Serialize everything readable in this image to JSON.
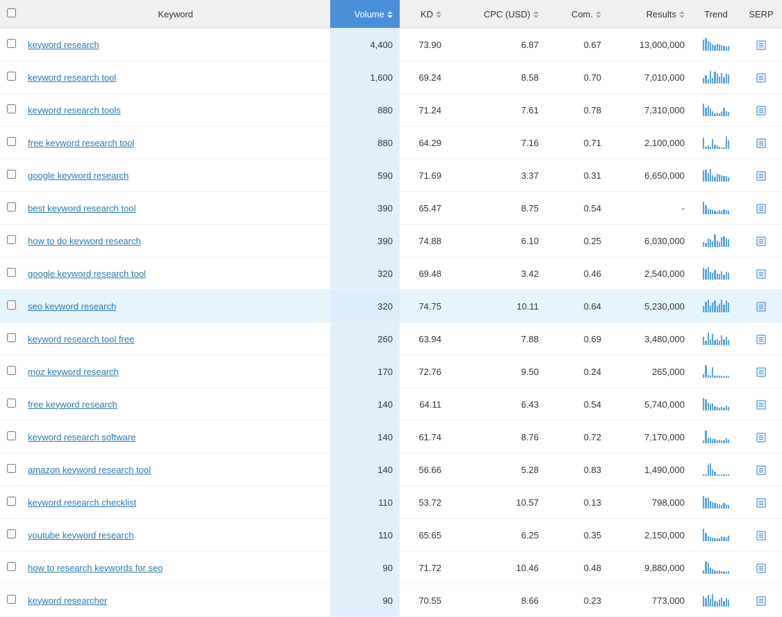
{
  "headers": {
    "keyword": "Keyword",
    "volume": "Volume",
    "kd": "KD",
    "cpc": "CPC (USD)",
    "com": "Com.",
    "results": "Results",
    "trend": "Trend",
    "serp": "SERP"
  },
  "highlight_index": 8,
  "rows": [
    {
      "keyword": "keyword research",
      "volume": "4,400",
      "kd": "73.90",
      "cpc": "6.87",
      "com": "0.67",
      "results": "13,000,000",
      "trend": [
        70,
        80,
        60,
        55,
        40,
        35,
        45,
        38,
        35,
        30,
        28,
        30
      ]
    },
    {
      "keyword": "keyword research tool",
      "volume": "1,600",
      "kd": "69.24",
      "cpc": "8.58",
      "com": "0.70",
      "results": "7,010,000",
      "trend": [
        30,
        45,
        25,
        70,
        30,
        65,
        55,
        40,
        60,
        35,
        55,
        50
      ]
    },
    {
      "keyword": "keyword research tools",
      "volume": "880",
      "kd": "71.24",
      "cpc": "7.61",
      "com": "0.78",
      "results": "7,310,000",
      "trend": [
        90,
        60,
        75,
        55,
        35,
        20,
        25,
        22,
        28,
        60,
        35,
        30
      ]
    },
    {
      "keyword": "free keyword research tool",
      "volume": "880",
      "kd": "64.29",
      "cpc": "7.16",
      "com": "0.71",
      "results": "2,100,000",
      "trend": [
        70,
        15,
        20,
        15,
        60,
        25,
        20,
        15,
        10,
        10,
        80,
        55
      ]
    },
    {
      "keyword": "google keyword research",
      "volume": "590",
      "kd": "71.69",
      "cpc": "3.37",
      "com": "0.31",
      "results": "6,650,000",
      "trend": [
        80,
        85,
        60,
        90,
        45,
        35,
        55,
        50,
        45,
        38,
        40,
        30
      ]
    },
    {
      "keyword": "best keyword research tool",
      "volume": "390",
      "kd": "65.47",
      "cpc": "8.75",
      "com": "0.54",
      "results": "-",
      "trend": [
        90,
        65,
        40,
        35,
        30,
        25,
        20,
        30,
        25,
        35,
        30,
        25
      ]
    },
    {
      "keyword": "how to do keyword research",
      "volume": "390",
      "kd": "74.88",
      "cpc": "6.10",
      "com": "0.25",
      "results": "6,030,000",
      "trend": [
        30,
        25,
        55,
        50,
        35,
        80,
        40,
        30,
        60,
        65,
        55,
        50
      ]
    },
    {
      "keyword": "google keyword research tool",
      "volume": "320",
      "kd": "69.48",
      "cpc": "3.42",
      "com": "0.46",
      "results": "2,540,000",
      "trend": [
        85,
        75,
        90,
        55,
        50,
        70,
        45,
        40,
        60,
        35,
        55,
        50
      ]
    },
    {
      "keyword": "seo keyword research",
      "volume": "320",
      "kd": "74.75",
      "cpc": "10.11",
      "com": "0.64",
      "results": "5,230,000",
      "trend": [
        45,
        75,
        90,
        50,
        70,
        85,
        45,
        60,
        90,
        55,
        85,
        70
      ]
    },
    {
      "keyword": "keyword research tool free",
      "volume": "260",
      "kd": "63.94",
      "cpc": "7.88",
      "com": "0.69",
      "results": "3,480,000",
      "trend": [
        55,
        25,
        80,
        35,
        70,
        30,
        35,
        25,
        60,
        35,
        55,
        30
      ]
    },
    {
      "keyword": "moz keyword research",
      "volume": "170",
      "kd": "72.76",
      "cpc": "9.50",
      "com": "0.24",
      "results": "265,000",
      "trend": [
        20,
        70,
        15,
        10,
        60,
        10,
        12,
        10,
        10,
        8,
        10,
        8
      ]
    },
    {
      "keyword": "free keyword research",
      "volume": "140",
      "kd": "64.11",
      "cpc": "6.43",
      "com": "0.54",
      "results": "5,740,000",
      "trend": [
        90,
        80,
        55,
        45,
        50,
        30,
        25,
        20,
        25,
        22,
        35,
        25
      ]
    },
    {
      "keyword": "keyword research software",
      "volume": "140",
      "kd": "61.74",
      "cpc": "8.76",
      "com": "0.72",
      "results": "7,170,000",
      "trend": [
        20,
        90,
        35,
        40,
        30,
        28,
        22,
        25,
        20,
        22,
        35,
        25
      ]
    },
    {
      "keyword": "amazon keyword research tool",
      "volume": "140",
      "kd": "56.66",
      "cpc": "5.28",
      "com": "0.83",
      "results": "1,490,000",
      "trend": [
        5,
        5,
        80,
        90,
        45,
        30,
        10,
        8,
        10,
        8,
        5,
        5
      ]
    },
    {
      "keyword": "keyword research checklist",
      "volume": "110",
      "kd": "53.72",
      "cpc": "10.57",
      "com": "0.13",
      "results": "798,000",
      "trend": [
        90,
        75,
        80,
        55,
        45,
        40,
        35,
        30,
        25,
        40,
        30,
        25
      ]
    },
    {
      "keyword": "youtube keyword research",
      "volume": "110",
      "kd": "65.65",
      "cpc": "6.25",
      "com": "0.35",
      "results": "2,150,000",
      "trend": [
        90,
        60,
        35,
        30,
        25,
        20,
        18,
        22,
        35,
        30,
        25,
        40
      ]
    },
    {
      "keyword": "how to research keywords for seo",
      "volume": "90",
      "kd": "71.72",
      "cpc": "10.46",
      "com": "0.48",
      "results": "9,880,000",
      "trend": [
        25,
        90,
        80,
        45,
        35,
        25,
        20,
        25,
        22,
        18,
        15,
        20
      ]
    },
    {
      "keyword": "keyword researcher",
      "volume": "90",
      "kd": "70.55",
      "cpc": "8.66",
      "com": "0.23",
      "results": "773,000",
      "trend": [
        70,
        55,
        80,
        50,
        85,
        40,
        35,
        45,
        60,
        40,
        55,
        45
      ]
    }
  ]
}
